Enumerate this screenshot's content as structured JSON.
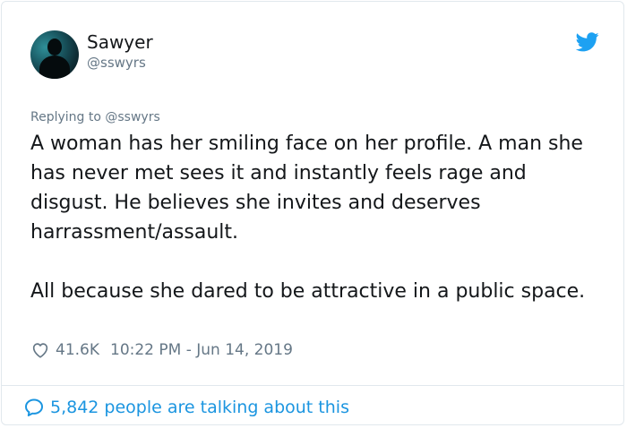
{
  "user": {
    "display_name": "Sawyer",
    "handle": "@sswyrs"
  },
  "tweet": {
    "reply_to": "Replying to @sswyrs",
    "text": "A woman has her smiling face on her profile. A man she has never met sees it and instantly feels rage and disgust. He believes she invites and deserves harrassment/assault.\n\nAll because she dared to be attractive in a public space.",
    "likes": "41.6K",
    "timestamp": "10:22 PM - Jun 14, 2019"
  },
  "footer": {
    "talking_label": "5,842 people are talking about this"
  },
  "colors": {
    "twitter_blue": "#1da1f2",
    "link_blue": "#1b95e0",
    "muted_gray": "#657786"
  },
  "icons": [
    "twitter-bird-icon",
    "heart-icon",
    "speech-bubble-icon"
  ]
}
